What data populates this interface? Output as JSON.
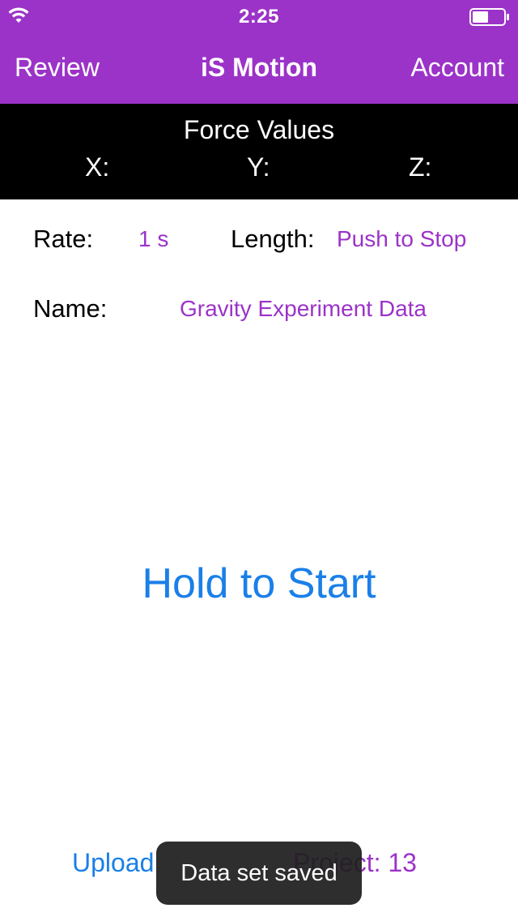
{
  "status_bar": {
    "time": "2:25",
    "wifi_icon": "wifi-icon",
    "battery_icon": "battery-icon"
  },
  "nav": {
    "left_label": "Review",
    "title": "iS Motion",
    "right_label": "Account"
  },
  "force_panel": {
    "title": "Force Values",
    "x_label": "X:",
    "y_label": "Y:",
    "z_label": "Z:"
  },
  "settings": {
    "rate_label": "Rate:",
    "rate_value": "1 s",
    "length_label": "Length:",
    "length_value": "Push to Stop",
    "name_label": "Name:",
    "name_value": "Gravity Experiment Data"
  },
  "main": {
    "start_label": "Hold to Start"
  },
  "footer": {
    "upload_label": "Upload",
    "project_label": "Project: 13"
  },
  "toast": {
    "message": "Data set saved"
  },
  "colors": {
    "brand_purple": "#9b33c8",
    "link_blue": "#1a7fe8",
    "panel_black": "#000000"
  }
}
